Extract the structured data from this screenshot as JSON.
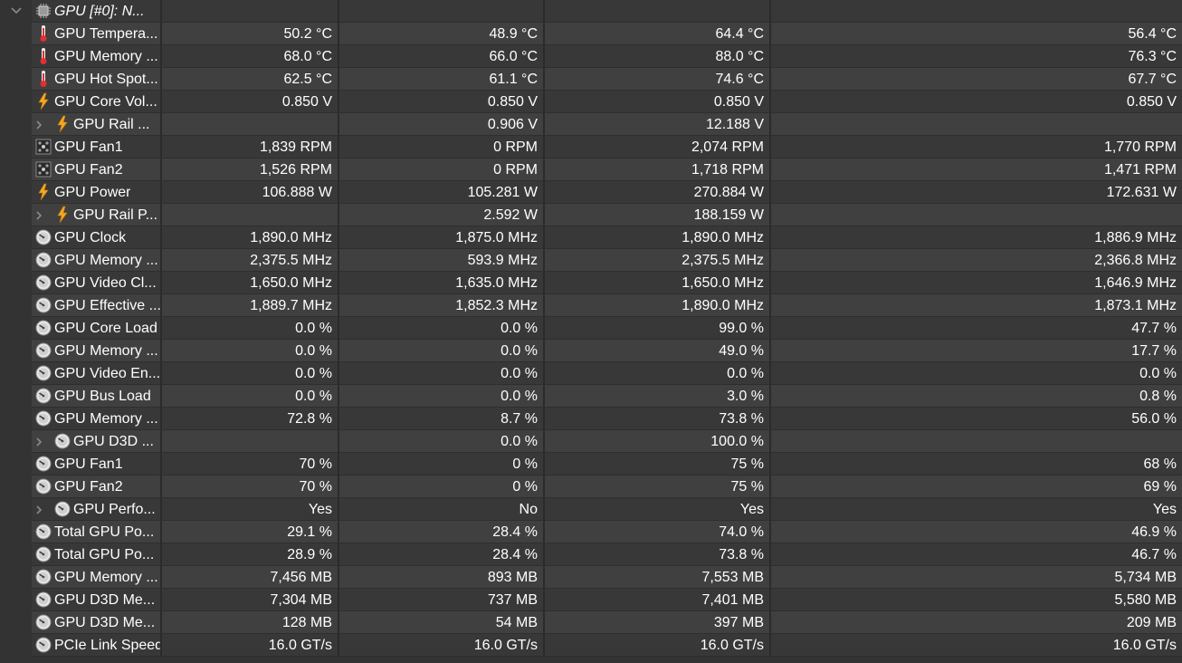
{
  "header": {
    "device_label": "GPU [#0]: N...",
    "chip_icon": "chip-icon",
    "collapse_icon": "chevron-down-icon"
  },
  "rows": [
    {
      "icon": "thermometer-icon",
      "sub": false,
      "label": "GPU Tempera...",
      "v1": "50.2 °C",
      "v2": "48.9 °C",
      "v3": "64.4 °C",
      "v4": "56.4 °C"
    },
    {
      "icon": "thermometer-icon",
      "sub": false,
      "label": "GPU Memory ...",
      "v1": "68.0 °C",
      "v2": "66.0 °C",
      "v3": "88.0 °C",
      "v4": "76.3 °C"
    },
    {
      "icon": "thermometer-icon",
      "sub": false,
      "label": "GPU Hot Spot...",
      "v1": "62.5 °C",
      "v2": "61.1 °C",
      "v3": "74.6 °C",
      "v4": "67.7 °C"
    },
    {
      "icon": "lightning-icon",
      "sub": false,
      "label": "GPU Core Vol...",
      "v1": "0.850 V",
      "v2": "0.850 V",
      "v3": "0.850 V",
      "v4": "0.850 V"
    },
    {
      "icon": "lightning-icon",
      "sub": true,
      "label": "GPU Rail ...",
      "v1": "",
      "v2": "0.906 V",
      "v3": "12.188 V",
      "v4": ""
    },
    {
      "icon": "fan-icon",
      "sub": false,
      "label": "GPU Fan1",
      "v1": "1,839 RPM",
      "v2": "0 RPM",
      "v3": "2,074 RPM",
      "v4": "1,770 RPM"
    },
    {
      "icon": "fan-icon",
      "sub": false,
      "label": "GPU Fan2",
      "v1": "1,526 RPM",
      "v2": "0 RPM",
      "v3": "1,718 RPM",
      "v4": "1,471 RPM"
    },
    {
      "icon": "lightning-icon",
      "sub": false,
      "label": "GPU Power",
      "v1": "106.888 W",
      "v2": "105.281 W",
      "v3": "270.884 W",
      "v4": "172.631 W"
    },
    {
      "icon": "lightning-icon",
      "sub": true,
      "label": "GPU Rail P...",
      "v1": "",
      "v2": "2.592 W",
      "v3": "188.159 W",
      "v4": ""
    },
    {
      "icon": "gauge-icon",
      "sub": false,
      "label": "GPU Clock",
      "v1": "1,890.0 MHz",
      "v2": "1,875.0 MHz",
      "v3": "1,890.0 MHz",
      "v4": "1,886.9 MHz"
    },
    {
      "icon": "gauge-icon",
      "sub": false,
      "label": "GPU Memory ...",
      "v1": "2,375.5 MHz",
      "v2": "593.9 MHz",
      "v3": "2,375.5 MHz",
      "v4": "2,366.8 MHz"
    },
    {
      "icon": "gauge-icon",
      "sub": false,
      "label": "GPU Video Cl...",
      "v1": "1,650.0 MHz",
      "v2": "1,635.0 MHz",
      "v3": "1,650.0 MHz",
      "v4": "1,646.9 MHz"
    },
    {
      "icon": "gauge-icon",
      "sub": false,
      "label": "GPU Effective ...",
      "v1": "1,889.7 MHz",
      "v2": "1,852.3 MHz",
      "v3": "1,890.0 MHz",
      "v4": "1,873.1 MHz"
    },
    {
      "icon": "gauge-icon",
      "sub": false,
      "label": "GPU Core Load",
      "v1": "0.0 %",
      "v2": "0.0 %",
      "v3": "99.0 %",
      "v4": "47.7 %"
    },
    {
      "icon": "gauge-icon",
      "sub": false,
      "label": "GPU Memory ...",
      "v1": "0.0 %",
      "v2": "0.0 %",
      "v3": "49.0 %",
      "v4": "17.7 %"
    },
    {
      "icon": "gauge-icon",
      "sub": false,
      "label": "GPU Video En...",
      "v1": "0.0 %",
      "v2": "0.0 %",
      "v3": "0.0 %",
      "v4": "0.0 %"
    },
    {
      "icon": "gauge-icon",
      "sub": false,
      "label": "GPU Bus Load",
      "v1": "0.0 %",
      "v2": "0.0 %",
      "v3": "3.0 %",
      "v4": "0.8 %"
    },
    {
      "icon": "gauge-icon",
      "sub": false,
      "label": "GPU Memory ...",
      "v1": "72.8 %",
      "v2": "8.7 %",
      "v3": "73.8 %",
      "v4": "56.0 %"
    },
    {
      "icon": "gauge-icon",
      "sub": true,
      "label": "GPU D3D ...",
      "v1": "",
      "v2": "0.0 %",
      "v3": "100.0 %",
      "v4": ""
    },
    {
      "icon": "gauge-icon",
      "sub": false,
      "label": "GPU Fan1",
      "v1": "70 %",
      "v2": "0 %",
      "v3": "75 %",
      "v4": "68 %"
    },
    {
      "icon": "gauge-icon",
      "sub": false,
      "label": "GPU Fan2",
      "v1": "70 %",
      "v2": "0 %",
      "v3": "75 %",
      "v4": "69 %"
    },
    {
      "icon": "gauge-icon",
      "sub": true,
      "label": "GPU Perfo...",
      "v1": "Yes",
      "v2": "No",
      "v3": "Yes",
      "v4": "Yes"
    },
    {
      "icon": "gauge-icon",
      "sub": false,
      "label": "Total GPU Po...",
      "v1": "29.1 %",
      "v2": "28.4 %",
      "v3": "74.0 %",
      "v4": "46.9 %"
    },
    {
      "icon": "gauge-icon",
      "sub": false,
      "label": "Total GPU Po...",
      "v1": "28.9 %",
      "v2": "28.4 %",
      "v3": "73.8 %",
      "v4": "46.7 %"
    },
    {
      "icon": "gauge-icon",
      "sub": false,
      "label": "GPU Memory ...",
      "v1": "7,456 MB",
      "v2": "893 MB",
      "v3": "7,553 MB",
      "v4": "5,734 MB"
    },
    {
      "icon": "gauge-icon",
      "sub": false,
      "label": "GPU D3D Me...",
      "v1": "7,304 MB",
      "v2": "737 MB",
      "v3": "7,401 MB",
      "v4": "5,580 MB"
    },
    {
      "icon": "gauge-icon",
      "sub": false,
      "label": "GPU D3D Me...",
      "v1": "128 MB",
      "v2": "54 MB",
      "v3": "397 MB",
      "v4": "209 MB"
    },
    {
      "icon": "gauge-icon",
      "sub": false,
      "label": "PCIe Link Speed",
      "v1": "16.0 GT/s",
      "v2": "16.0 GT/s",
      "v3": "16.0 GT/s",
      "v4": "16.0 GT/s"
    }
  ],
  "colors": {
    "background": "#333333",
    "row_odd": "#404040",
    "row_even": "#383838",
    "text": "#ffffff",
    "thermometer": "#e03030",
    "lightning": "#f5a623"
  }
}
